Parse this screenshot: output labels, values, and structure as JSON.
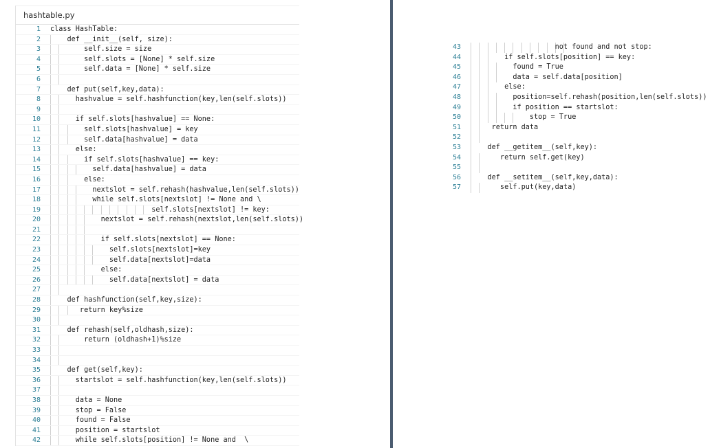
{
  "document": {
    "file_title": "hashtable.py",
    "language": "python",
    "divider_color": "#4b5c70",
    "line_number_color": "#2d7f96",
    "code_text_color": "#222222",
    "indent_guide_color": "#cfcfcf",
    "background_color": "#ffffff"
  },
  "columns": [
    {
      "name": "left-column",
      "first_line": 1,
      "last_line": 42,
      "lines": [
        {
          "n": "1",
          "guides": 0,
          "text": "class HashTable:"
        },
        {
          "n": "2",
          "guides": 1,
          "text": "    def __init__(self, size):"
        },
        {
          "n": "3",
          "guides": 2,
          "text": "        self.size = size"
        },
        {
          "n": "4",
          "guides": 2,
          "text": "        self.slots = [None] * self.size"
        },
        {
          "n": "5",
          "guides": 2,
          "text": "        self.data = [None] * self.size"
        },
        {
          "n": "6",
          "guides": 2,
          "text": ""
        },
        {
          "n": "7",
          "guides": 1,
          "text": "    def put(self,key,data):"
        },
        {
          "n": "8",
          "guides": 2,
          "text": "      hashvalue = self.hashfunction(key,len(self.slots))"
        },
        {
          "n": "9",
          "guides": 2,
          "text": ""
        },
        {
          "n": "10",
          "guides": 2,
          "text": "      if self.slots[hashvalue] == None:"
        },
        {
          "n": "11",
          "guides": 3,
          "text": "        self.slots[hashvalue] = key"
        },
        {
          "n": "12",
          "guides": 3,
          "text": "        self.data[hashvalue] = data"
        },
        {
          "n": "13",
          "guides": 2,
          "text": "      else:"
        },
        {
          "n": "14",
          "guides": 3,
          "text": "        if self.slots[hashvalue] == key:"
        },
        {
          "n": "15",
          "guides": 4,
          "text": "          self.data[hashvalue] = data"
        },
        {
          "n": "16",
          "guides": 3,
          "text": "        else:"
        },
        {
          "n": "17",
          "guides": 4,
          "text": "          nextslot = self.rehash(hashvalue,len(self.slots))"
        },
        {
          "n": "18",
          "guides": 4,
          "text": "          while self.slots[nextslot] != None and \\"
        },
        {
          "n": "19",
          "guides": 12,
          "text": "                        self.slots[nextslot] != key:"
        },
        {
          "n": "20",
          "guides": 5,
          "text": "            nextslot = self.rehash(nextslot,len(self.slots))"
        },
        {
          "n": "21",
          "guides": 5,
          "text": ""
        },
        {
          "n": "22",
          "guides": 5,
          "text": "            if self.slots[nextslot] == None:"
        },
        {
          "n": "23",
          "guides": 6,
          "text": "              self.slots[nextslot]=key"
        },
        {
          "n": "24",
          "guides": 6,
          "text": "              self.data[nextslot]=data"
        },
        {
          "n": "25",
          "guides": 5,
          "text": "            else:"
        },
        {
          "n": "26",
          "guides": 6,
          "text": "              self.data[nextslot] = data"
        },
        {
          "n": "27",
          "guides": 2,
          "text": ""
        },
        {
          "n": "28",
          "guides": 1,
          "text": "    def hashfunction(self,key,size):"
        },
        {
          "n": "29",
          "guides": 3,
          "text": "       return key%size"
        },
        {
          "n": "30",
          "guides": 2,
          "text": ""
        },
        {
          "n": "31",
          "guides": 1,
          "text": "    def rehash(self,oldhash,size):"
        },
        {
          "n": "32",
          "guides": 2,
          "text": "        return (oldhash+1)%size"
        },
        {
          "n": "33",
          "guides": 2,
          "text": ""
        },
        {
          "n": "34",
          "guides": 2,
          "text": ""
        },
        {
          "n": "35",
          "guides": 1,
          "text": "    def get(self,key):"
        },
        {
          "n": "36",
          "guides": 2,
          "text": "      startslot = self.hashfunction(key,len(self.slots))"
        },
        {
          "n": "37",
          "guides": 2,
          "text": ""
        },
        {
          "n": "38",
          "guides": 2,
          "text": "      data = None"
        },
        {
          "n": "39",
          "guides": 2,
          "text": "      stop = False"
        },
        {
          "n": "40",
          "guides": 2,
          "text": "      found = False"
        },
        {
          "n": "41",
          "guides": 2,
          "text": "      position = startslot"
        },
        {
          "n": "42",
          "guides": 2,
          "text": "      while self.slots[position] != None and  \\"
        }
      ]
    },
    {
      "name": "right-column",
      "first_line": 43,
      "last_line": 57,
      "lines": [
        {
          "n": "43",
          "guides": 12,
          "text": "                    not found and not stop:"
        },
        {
          "n": "44",
          "guides": 3,
          "text": "        if self.slots[position] == key:"
        },
        {
          "n": "45",
          "guides": 4,
          "text": "          found = True"
        },
        {
          "n": "46",
          "guides": 4,
          "text": "          data = self.data[position]"
        },
        {
          "n": "47",
          "guides": 3,
          "text": "        else:"
        },
        {
          "n": "48",
          "guides": 4,
          "text": "          position=self.rehash(position,len(self.slots))"
        },
        {
          "n": "49",
          "guides": 4,
          "text": "          if position == startslot:"
        },
        {
          "n": "50",
          "guides": 6,
          "text": "              stop = True"
        },
        {
          "n": "51",
          "guides": 2,
          "text": "     return data"
        },
        {
          "n": "52",
          "guides": 2,
          "text": ""
        },
        {
          "n": "53",
          "guides": 1,
          "text": "    def __getitem__(self,key):"
        },
        {
          "n": "54",
          "guides": 2,
          "text": "       return self.get(key)"
        },
        {
          "n": "55",
          "guides": 2,
          "text": ""
        },
        {
          "n": "56",
          "guides": 1,
          "text": "    def __setitem__(self,key,data):"
        },
        {
          "n": "57",
          "guides": 2,
          "text": "       self.put(key,data)"
        }
      ]
    }
  ]
}
